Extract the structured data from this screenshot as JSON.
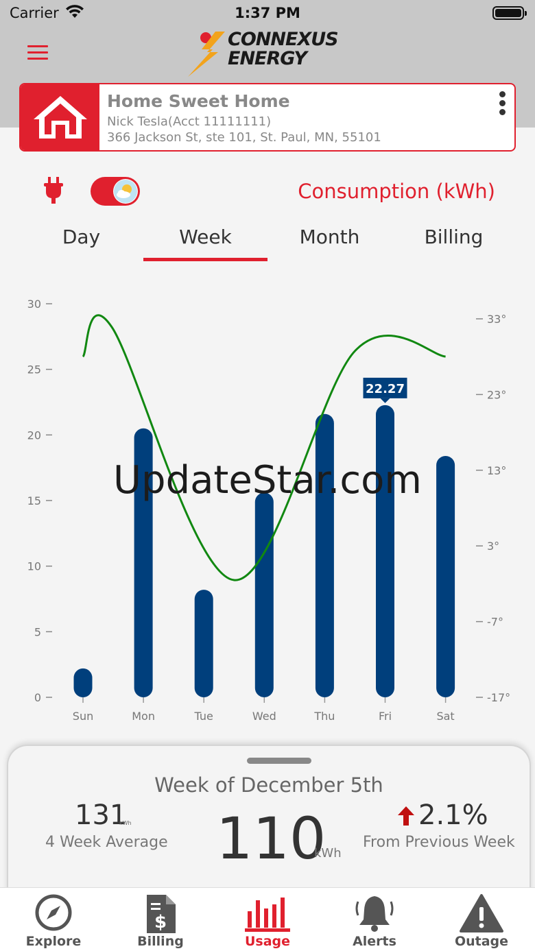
{
  "status_bar": {
    "carrier": "Carrier",
    "time": "1:37 PM"
  },
  "brand": {
    "name_line1": "CONNEXUS",
    "name_line2": "ENERGY",
    "accent": "#e0202e"
  },
  "account": {
    "name": "Home Sweet Home",
    "holder": "Nick Tesla(Acct 11111111)",
    "address": "366 Jackson St, ste 101, St. Paul, MN, 55101"
  },
  "usage": {
    "mode_title": "Consumption (kWh)",
    "weather_overlay_on": true,
    "tabs": [
      {
        "label": "Day",
        "active": false
      },
      {
        "label": "Week",
        "active": true
      },
      {
        "label": "Month",
        "active": false
      },
      {
        "label": "Billing",
        "active": false
      }
    ]
  },
  "chart_data": {
    "type": "bar",
    "categories": [
      "Sun",
      "Mon",
      "Tue",
      "Wed",
      "Thu",
      "Fri",
      "Sat"
    ],
    "series": [
      {
        "values": [
          2.2,
          20.5,
          8.2,
          15.6,
          21.6,
          22.27,
          18.4
        ],
        "color": "#003f7c"
      },
      {
        "type": "line",
        "axis": "right",
        "values": [
          28,
          28,
          -5,
          3,
          29,
          28,
          28
        ],
        "color": "#118811"
      }
    ],
    "y_ticks": [
      "30",
      "25",
      "20",
      "15",
      "10",
      "5",
      "0"
    ],
    "y_right_ticks": [
      "33°",
      "23°",
      "13°",
      "3°",
      "-7°",
      "-17°"
    ],
    "ylim": [
      0,
      30
    ],
    "ylim_right": [
      -17,
      35
    ],
    "highlight": {
      "index": 5,
      "label": "22.27"
    }
  },
  "watermark": "UpdateStar.com",
  "summary": {
    "title": "Week of December 5th",
    "average_value": "131",
    "average_unit": "kWh",
    "average_label": "4 Week Average",
    "total_value": "110",
    "total_unit": "kWh",
    "change_value": "2.1%",
    "change_label": "From Previous Week"
  },
  "tabbar": {
    "items": [
      {
        "label": "Explore",
        "icon": "compass-icon"
      },
      {
        "label": "Billing",
        "icon": "bill-icon"
      },
      {
        "label": "Usage",
        "icon": "bar-chart-icon",
        "active": true
      },
      {
        "label": "Alerts",
        "icon": "bell-icon"
      },
      {
        "label": "Outage",
        "icon": "warning-icon"
      }
    ]
  }
}
